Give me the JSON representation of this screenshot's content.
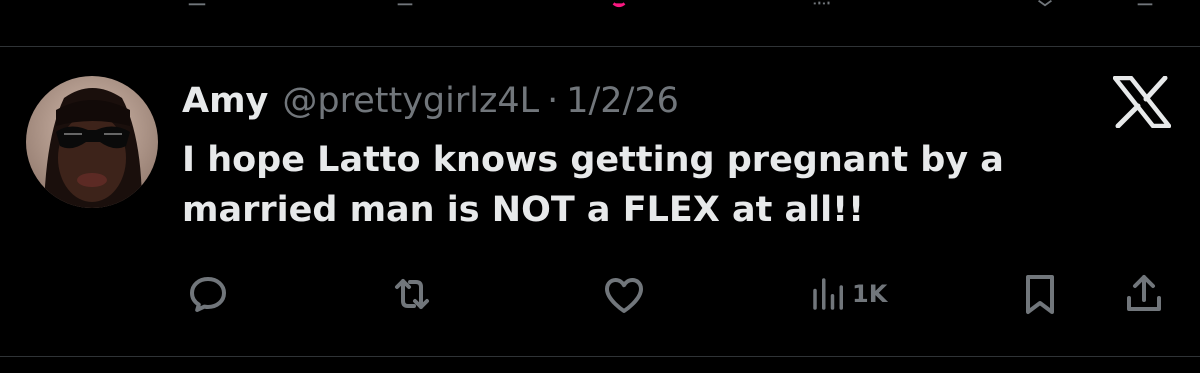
{
  "tweet": {
    "display_name": "Amy",
    "handle": "@prettygirlz4L",
    "separator": "·",
    "date": "1/2/26",
    "text": "I hope Latto knows getting pregnant by a married man is NOT a FLEX at all!!"
  },
  "actions": {
    "reply_icon": "reply-icon",
    "retweet_icon": "retweet-icon",
    "like_icon": "heart-icon",
    "views_icon": "views-icon",
    "views_count": "1K",
    "bookmark_icon": "bookmark-icon",
    "share_icon": "share-icon"
  },
  "colors": {
    "background": "#000000",
    "text_primary": "#e7e9ea",
    "text_secondary": "#71767b",
    "divider": "#2f3336",
    "like_accent": "#f91880"
  }
}
